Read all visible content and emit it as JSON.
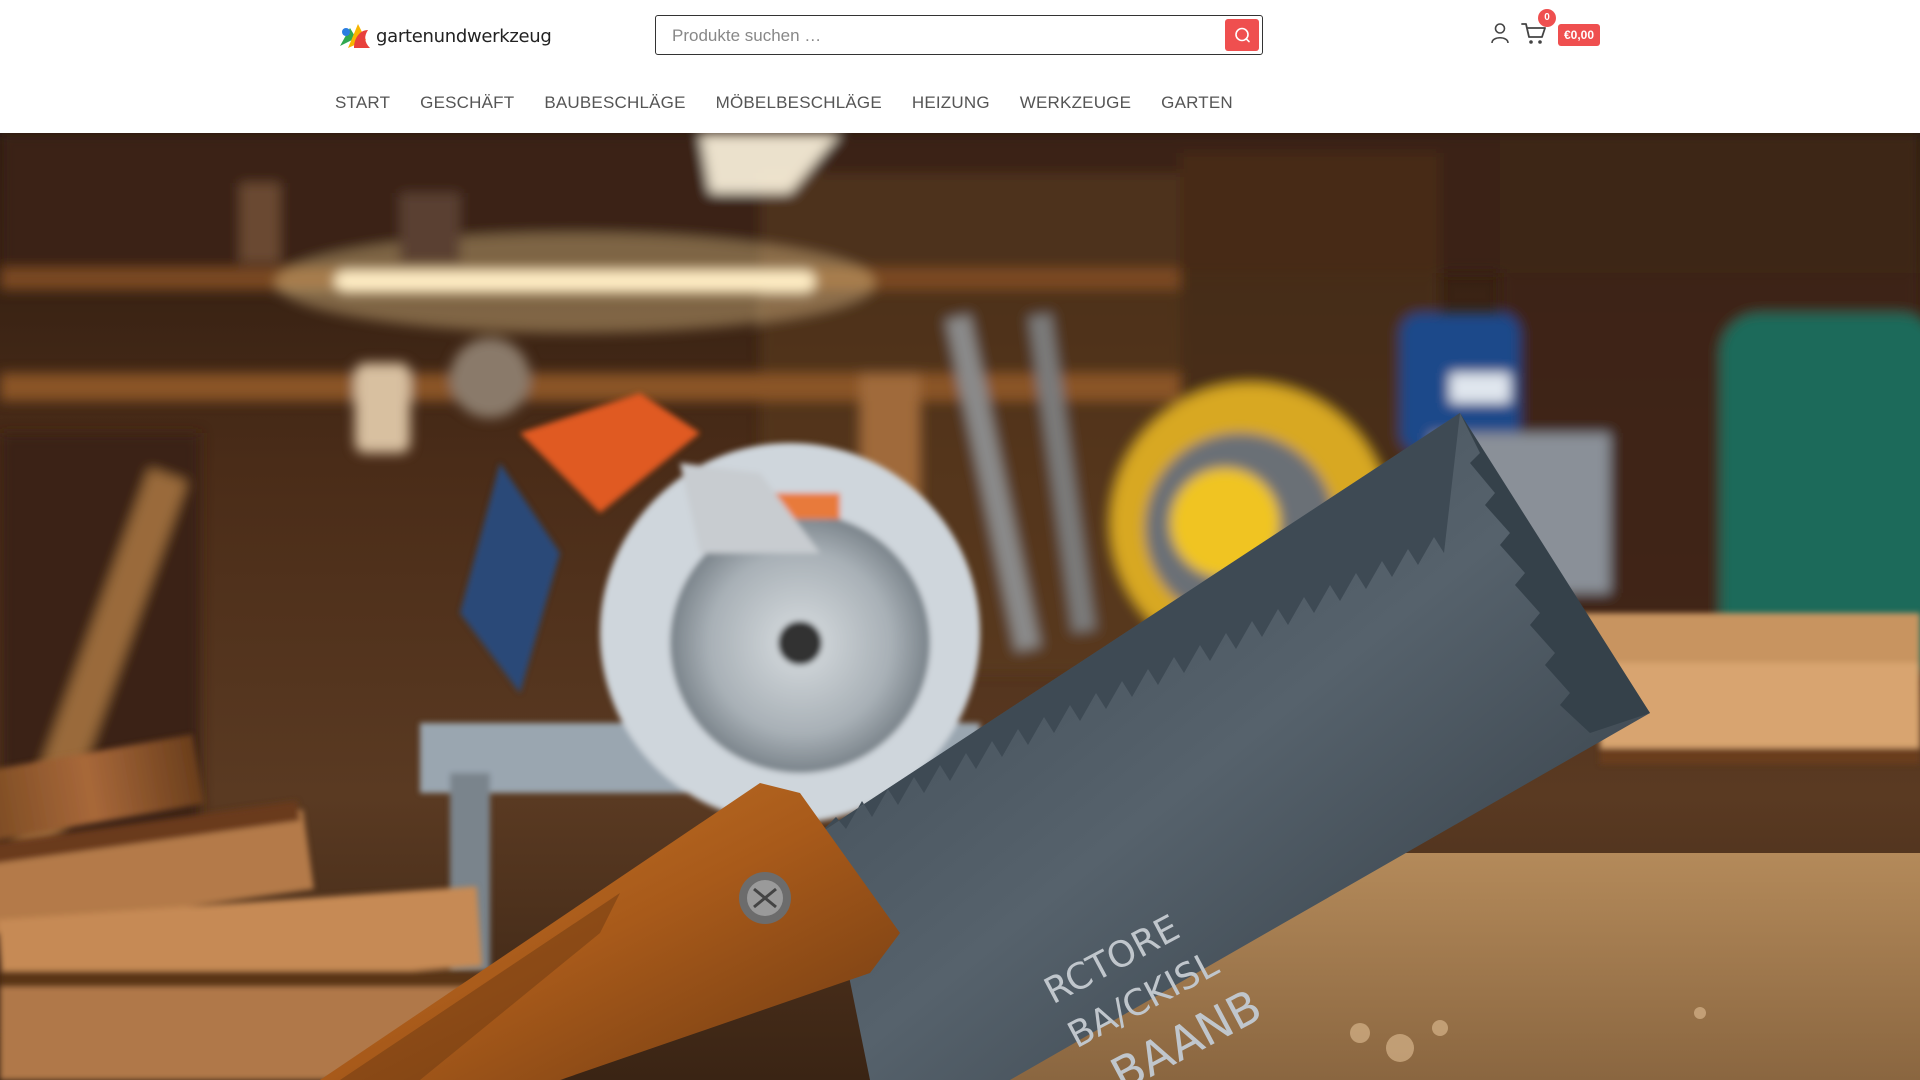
{
  "header": {
    "logo_text": "gartenundwerkzeug",
    "search_placeholder": "Produkte suchen …",
    "cart_count": "0",
    "cart_total": "€0,00"
  },
  "nav": {
    "items": [
      "START",
      "GESCHÄFT",
      "BAUBESCHLÄGE",
      "MÖBELBESCHLÄGE",
      "HEIZUNG",
      "WERKZEUGE",
      "GARTEN"
    ]
  },
  "hero": {
    "saw_engraving": [
      "RCTORE",
      "BA/CKISL",
      "BAANB"
    ]
  },
  "colors": {
    "accent": "#ef4f4f",
    "nav_text": "#555555"
  },
  "icons": [
    "logo-icon",
    "search-icon",
    "user-icon",
    "cart-icon"
  ]
}
